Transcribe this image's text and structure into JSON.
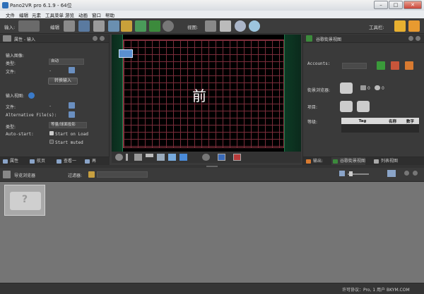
{
  "window": {
    "title": "Pano2VR pro 6.1.9 - 64位",
    "minimize": "–",
    "maximize": "□",
    "close": "✕"
  },
  "menu": [
    "文件",
    "编辑",
    "元素",
    "工具菜单",
    "游览",
    "动画",
    "窗口",
    "帮助"
  ],
  "toolbar": {
    "input_label": "输入:",
    "edit_label": "编辑",
    "view_label": "视图:",
    "tools_label": "工具栏:"
  },
  "left_panel": {
    "header": "属性 - 输入",
    "input_image_title": "输入图像:",
    "type_label": "类型:",
    "type_value": "自动",
    "file_label": "文件:",
    "file_value": "-",
    "convert_button": "转换输入",
    "input_view_title": "输入视图:",
    "view_file_label": "文件:",
    "view_file_value": "-",
    "alt_files_label": "Alternative File(s):",
    "alt_files_value": "-",
    "view_type_label": "类型:",
    "view_type_value": "等量/球面投影",
    "autostart_label": "Auto-start:",
    "start_on_load": "Start on Load",
    "start_muted": "Start muted",
    "tabs": [
      "属性",
      "航页",
      "查看一",
      "再"
    ]
  },
  "viewer": {
    "face_label": "前"
  },
  "right_panel": {
    "header": "谷歌街景视图",
    "accounts_label": "Accounts:",
    "panorama_browser_label": "街景浏览器:",
    "image_count": "0",
    "view_count": "0",
    "project_label": "项目:",
    "level_label": "等级:",
    "table_headers": [
      "Tag",
      "名称",
      "数字"
    ],
    "tabs": [
      "输出:",
      "谷歌街景视图",
      "列表视图"
    ]
  },
  "browser": {
    "title": "导览浏览器",
    "filter_label": "过滤器:"
  },
  "status": {
    "text": "许可协议：Pro, 1 用户 BKYM.COM"
  }
}
